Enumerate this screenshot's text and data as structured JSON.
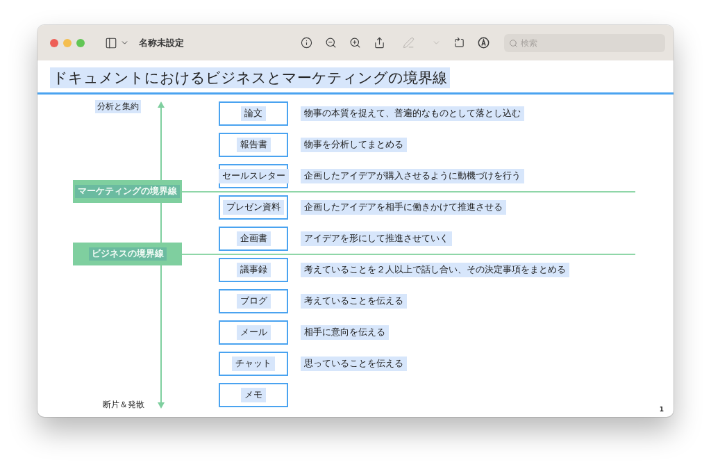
{
  "window": {
    "title": "名称未設定",
    "search": {
      "placeholder": "検索"
    },
    "toolbar": [
      {
        "kind": "info",
        "disabled": false
      },
      {
        "kind": "zoom-out",
        "disabled": false
      },
      {
        "kind": "zoom-in",
        "disabled": false
      },
      {
        "kind": "share",
        "disabled": false
      },
      {
        "kind": "pen",
        "disabled": true
      },
      {
        "kind": "chevron",
        "disabled": true
      },
      {
        "kind": "rotate",
        "disabled": false
      },
      {
        "kind": "markup",
        "disabled": false
      }
    ]
  },
  "document": {
    "title": "ドキュメントにおけるビジネスとマーケティングの境界線",
    "page_number": "1",
    "axis": {
      "top_label": {
        "text": "分析と集約",
        "highlighted": true
      },
      "bottom_label": {
        "text": "断片＆発散",
        "highlighted": false
      }
    },
    "items": [
      {
        "kind": "document",
        "name": "論文",
        "description": "物事の本質を捉えて、普遍的なものとして落とし込む"
      },
      {
        "kind": "document",
        "name": "報告書",
        "description": "物事を分析してまとめる"
      },
      {
        "kind": "document",
        "name": "セールスレター",
        "description": "企画したアイデアが購入させるように動機づけを行う"
      },
      {
        "kind": "boundary",
        "label": "マーケティングの境界線"
      },
      {
        "kind": "document",
        "name": "プレゼン資料",
        "description": "企画したアイデアを相手に働きかけて推進させる"
      },
      {
        "kind": "document",
        "name": "企画書",
        "description": "アイデアを形にして推進させていく"
      },
      {
        "kind": "boundary",
        "label": "ビジネスの境界線"
      },
      {
        "kind": "document",
        "name": "議事録",
        "description": "考えていることを２人以上で話し合い、その決定事項をまとめる"
      },
      {
        "kind": "document",
        "name": "ブログ",
        "description": "考えていることを伝える"
      },
      {
        "kind": "document",
        "name": "メール",
        "description": "相手に意向を伝える"
      },
      {
        "kind": "document",
        "name": "チャット",
        "description": "思っていることを伝える"
      },
      {
        "kind": "document",
        "name": "メモ"
      }
    ]
  }
}
